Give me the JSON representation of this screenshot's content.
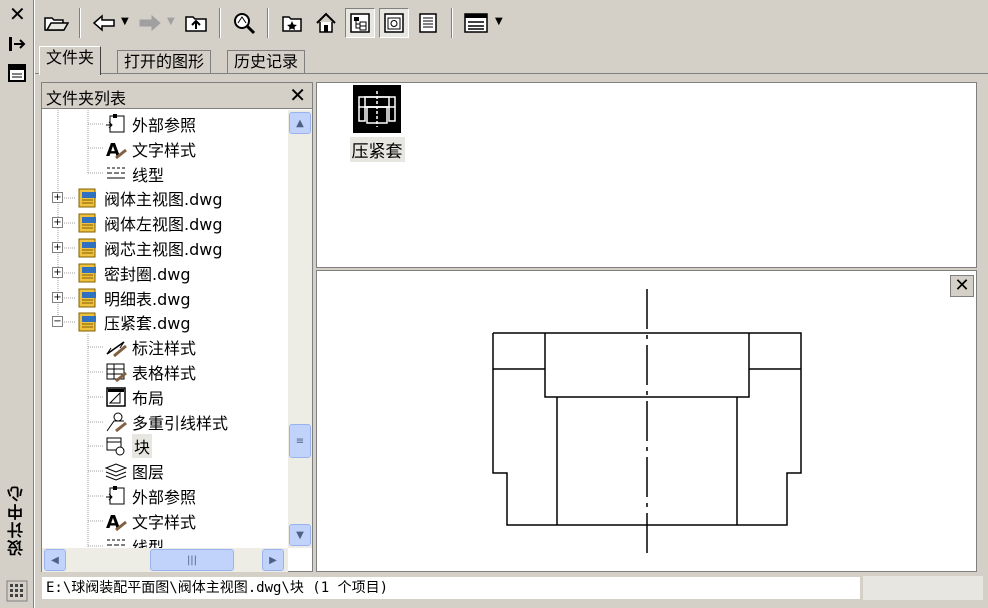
{
  "palette_title": "设计中心",
  "tabs": [
    {
      "label": "文件夹",
      "active": true
    },
    {
      "label": "打开的图形",
      "active": false
    },
    {
      "label": "历史记录",
      "active": false
    }
  ],
  "tree": {
    "title": "文件夹列表",
    "items": [
      {
        "label": "外部参照",
        "icon": "xref-icon"
      },
      {
        "label": "文字样式",
        "icon": "text-style-icon"
      },
      {
        "label": "线型",
        "icon": "linetype-icon"
      },
      {
        "label": "阀体主视图.dwg",
        "icon": "dwg-file-icon",
        "expander": "+"
      },
      {
        "label": "阀体左视图.dwg",
        "icon": "dwg-file-icon",
        "expander": "+"
      },
      {
        "label": "阀芯主视图.dwg",
        "icon": "dwg-file-icon",
        "expander": "+"
      },
      {
        "label": "密封圈.dwg",
        "icon": "dwg-file-icon",
        "expander": "+"
      },
      {
        "label": "明细表.dwg",
        "icon": "dwg-file-icon",
        "expander": "+"
      },
      {
        "label": "压紧套.dwg",
        "icon": "dwg-file-icon",
        "expander": "-"
      },
      {
        "label": "标注样式",
        "icon": "dim-style-icon"
      },
      {
        "label": "表格样式",
        "icon": "table-style-icon"
      },
      {
        "label": "布局",
        "icon": "layout-icon"
      },
      {
        "label": "多重引线样式",
        "icon": "mleader-style-icon"
      },
      {
        "label": "块",
        "icon": "block-icon",
        "selected": true
      },
      {
        "label": "图层",
        "icon": "layer-icon"
      },
      {
        "label": "外部参照",
        "icon": "xref-icon"
      },
      {
        "label": "文字样式",
        "icon": "text-style-icon"
      },
      {
        "label": "线型",
        "icon": "linetype-icon"
      }
    ]
  },
  "palette": {
    "items": [
      {
        "label": "压紧套"
      }
    ]
  },
  "status": "E:\\球阀装配平面图\\阀体主视图.dwg\\块 (1 个项目)",
  "colors": {
    "chrome": "#d4d0c8",
    "selection": "#e8e6e0",
    "scroll": "#c1d3fb"
  }
}
